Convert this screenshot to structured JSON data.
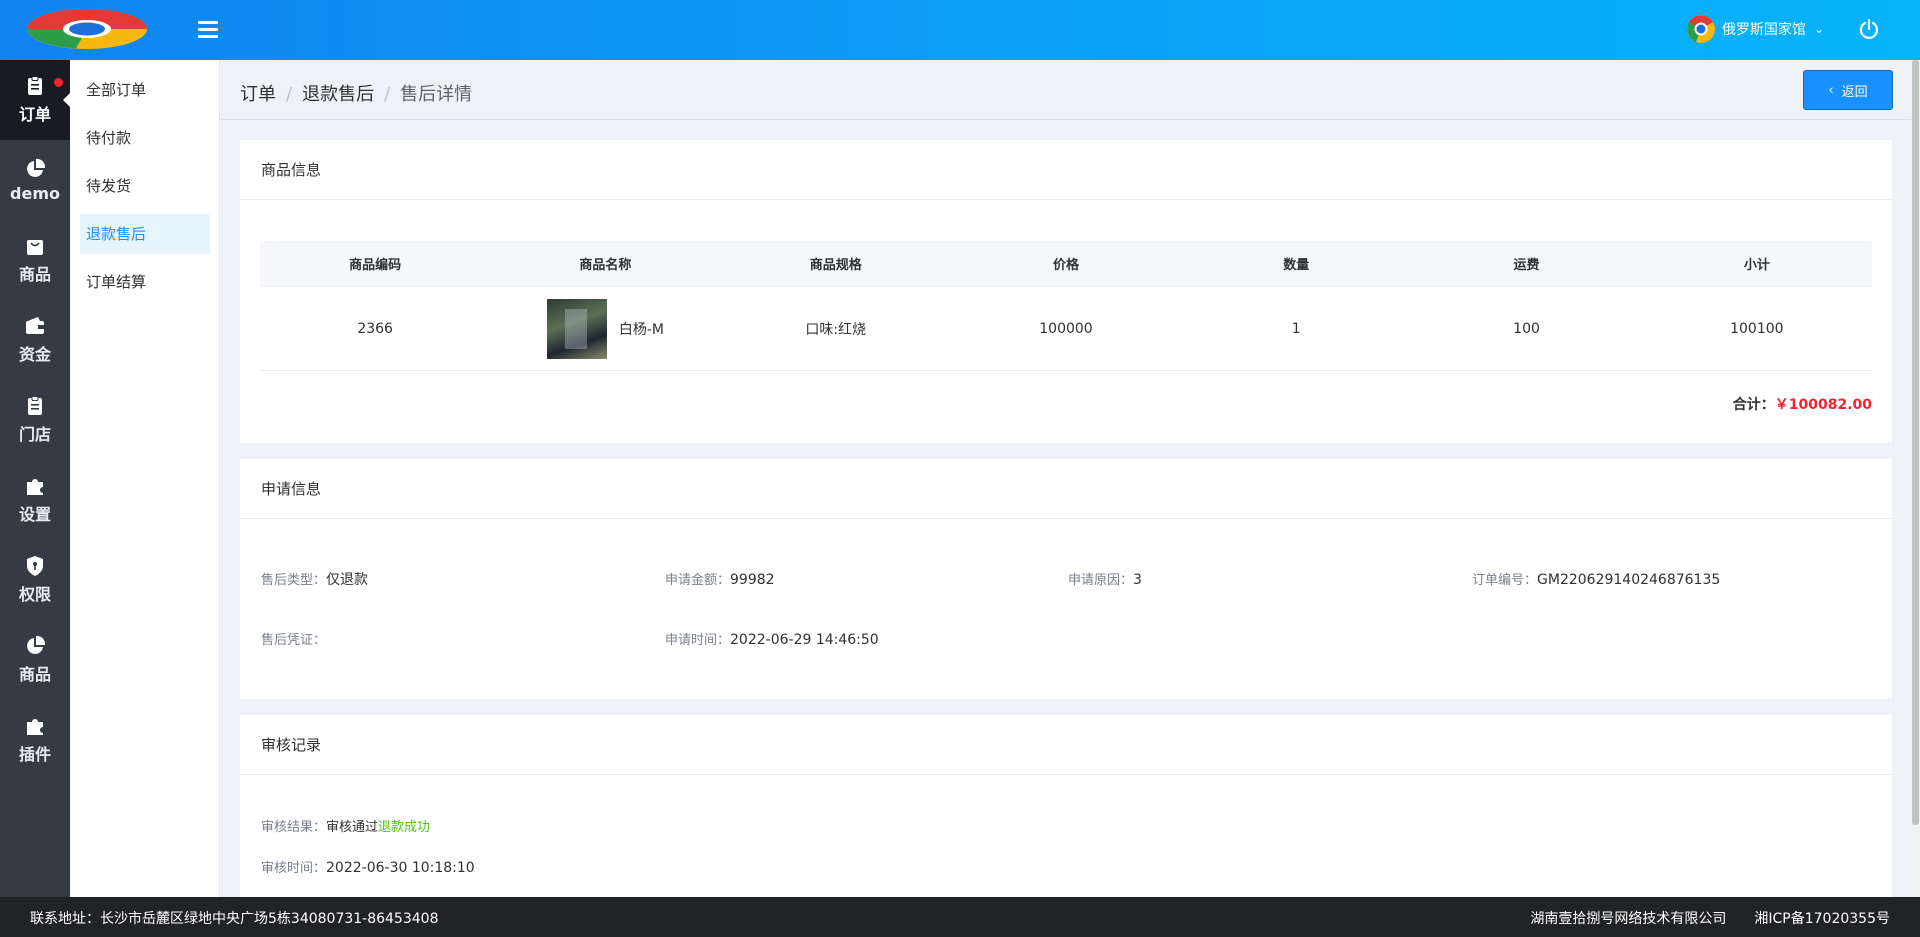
{
  "header": {
    "user_name": "俄罗斯国家馆",
    "brand_colors": [
      "#1183f1",
      "#06b4fb"
    ]
  },
  "sidebar": {
    "items": [
      {
        "label": "订单",
        "icon": "clipboard-icon",
        "active": true
      },
      {
        "label": "demo",
        "icon": "pie-chart-icon"
      },
      {
        "label": "商品",
        "icon": "bag-icon"
      },
      {
        "label": "资金",
        "icon": "wallet-icon"
      },
      {
        "label": "门店",
        "icon": "clipboard-icon"
      },
      {
        "label": "设置",
        "icon": "puzzle-icon"
      },
      {
        "label": "权限",
        "icon": "shield-icon"
      },
      {
        "label": "商品",
        "icon": "pie-chart-icon"
      },
      {
        "label": "插件",
        "icon": "puzzle-icon"
      }
    ]
  },
  "submenu": {
    "items": [
      {
        "label": "全部订单"
      },
      {
        "label": "待付款"
      },
      {
        "label": "待发货"
      },
      {
        "label": "退款售后",
        "active": true
      },
      {
        "label": "订单结算"
      }
    ]
  },
  "breadcrumb": {
    "items": [
      "订单",
      "退款售后",
      "售后详情"
    ]
  },
  "back_label": "返回",
  "product_card": {
    "title": "商品信息",
    "columns": [
      "商品编码",
      "商品名称",
      "商品规格",
      "价格",
      "数量",
      "运费",
      "小计"
    ],
    "rows": [
      {
        "code": "2366",
        "name": "白杨-M",
        "spec": "口味:红烧",
        "price": "100000",
        "qty": "1",
        "shipping": "100",
        "subtotal": "100100"
      }
    ],
    "total_label": "合计：",
    "total_value": "￥100082.00"
  },
  "apply_card": {
    "title": "申请信息",
    "type_label": "售后类型：",
    "type_value": "仅退款",
    "amount_label": "申请金额：",
    "amount_value": "99982",
    "reason_label": "申请原因：",
    "reason_value": "3",
    "order_label": "订单编号：",
    "order_value": "GM220629140246876135",
    "proof_label": "售后凭证：",
    "time_label": "申请时间：",
    "time_value": "2022-06-29 14:46:50"
  },
  "audit_card": {
    "title": "审核记录",
    "result_label": "审核结果：",
    "result_value": "审核通过",
    "result_status": "退款成功",
    "time_label": "审核时间：",
    "time_value": "2022-06-30 10:18:10"
  },
  "footer": {
    "address": "联系地址：长沙市岳麓区绿地中央广场5栋34080731-86453408",
    "company": "湖南壹拾捌号网络技术有限公司",
    "icp": "湘ICP备17020355号"
  }
}
